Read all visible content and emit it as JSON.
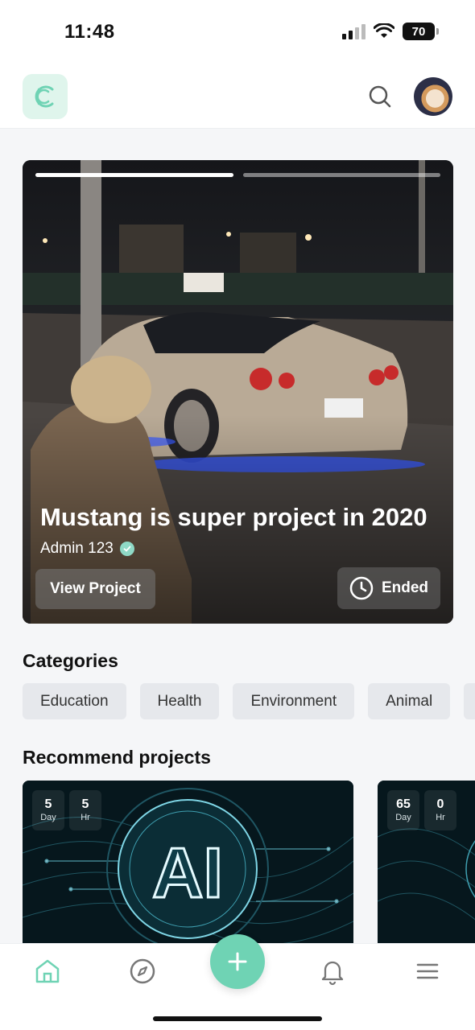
{
  "status_bar": {
    "time": "11:48",
    "battery": "70"
  },
  "header": {
    "logo_icon": "leaf-c-logo-icon",
    "search_icon": "search-icon"
  },
  "hero": {
    "title": "Mustang is super project in 2020",
    "author": "Admin 123",
    "view_button": "View Project",
    "status": "Ended",
    "story_progress": [
      1.0,
      0.0
    ]
  },
  "categories": {
    "title": "Categories",
    "items": [
      "Education",
      "Health",
      "Environment",
      "Animal"
    ]
  },
  "recommend": {
    "title": "Recommend projects",
    "cards": [
      {
        "image_text": "AI",
        "timer": [
          {
            "value": "5",
            "unit": "Day"
          },
          {
            "value": "5",
            "unit": "Hr"
          }
        ]
      },
      {
        "timer": [
          {
            "value": "65",
            "unit": "Day"
          },
          {
            "value": "0",
            "unit": "Hr"
          }
        ]
      }
    ]
  },
  "colors": {
    "accent": "#6fd3b4",
    "accent_light": "#dff5ec",
    "chip_bg": "#e6e8ec",
    "page_bg": "#f5f6f8"
  },
  "nav": {
    "items": [
      "home-icon",
      "compass-icon",
      "plus-icon",
      "bell-icon",
      "menu-icon"
    ]
  }
}
